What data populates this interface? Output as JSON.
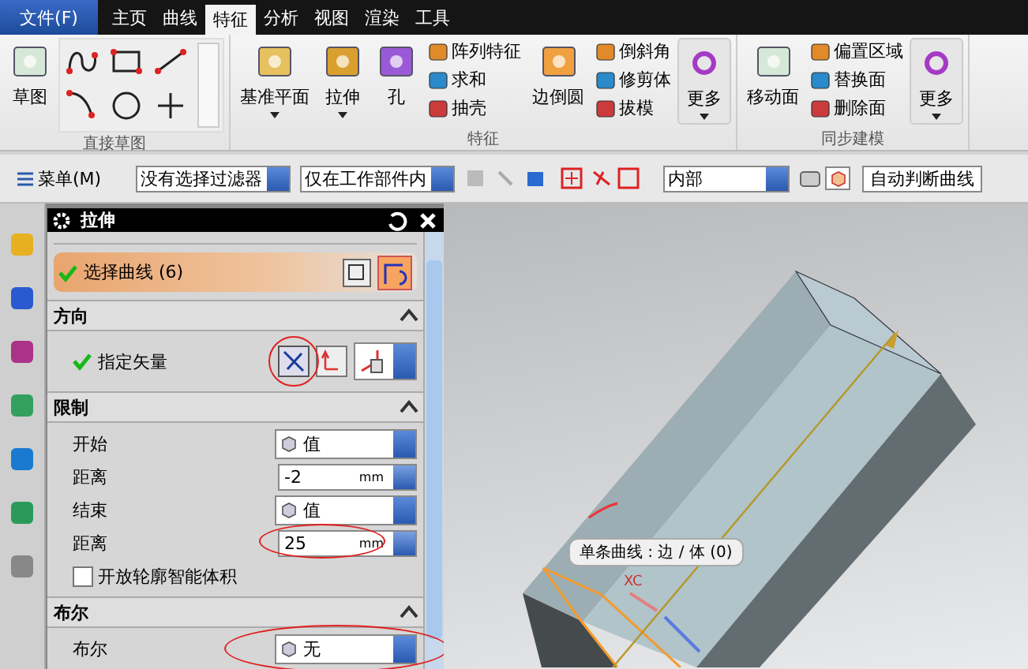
{
  "menu_bar": {
    "file_button": "文件(F)",
    "tabs": [
      {
        "label": "主页",
        "selected": false
      },
      {
        "label": "曲线",
        "selected": false
      },
      {
        "label": "特征",
        "selected": true
      },
      {
        "label": "分析",
        "selected": false
      },
      {
        "label": "视图",
        "selected": false
      },
      {
        "label": "渲染",
        "selected": false
      },
      {
        "label": "工具",
        "selected": false
      }
    ]
  },
  "ribbon": {
    "groups": [
      {
        "title": "直接草图",
        "items": [
          {
            "kind": "large",
            "label": "草图",
            "dropdown": false
          },
          {
            "kind": "sketch_tools"
          }
        ]
      },
      {
        "title": "特征",
        "items": [
          {
            "kind": "large",
            "label": "基准平面",
            "dropdown": true
          },
          {
            "kind": "large",
            "label": "拉伸",
            "dropdown": true
          },
          {
            "kind": "large",
            "label": "孔",
            "dropdown": false
          },
          {
            "kind": "stack",
            "labels": [
              "阵列特征",
              "求和",
              "抽壳"
            ]
          },
          {
            "kind": "large",
            "label": "边倒圆",
            "dropdown": false
          },
          {
            "kind": "stack",
            "labels": [
              "倒斜角",
              "修剪体",
              "拔模"
            ]
          },
          {
            "kind": "more",
            "label": "更多",
            "dropdown": true
          }
        ]
      },
      {
        "title": "同步建模",
        "items": [
          {
            "kind": "large",
            "label": "移动面",
            "dropdown": false
          },
          {
            "kind": "stack",
            "labels": [
              "偏置区域",
              "替换面",
              "删除面"
            ]
          },
          {
            "kind": "more",
            "label": "更多",
            "dropdown": true
          }
        ]
      }
    ]
  },
  "toolbar": {
    "menu_button": "菜单(M)",
    "filters": [
      "没有选择过滤器",
      "仅在工作部件内"
    ],
    "scope": "内部",
    "curve_rule": "自动判断曲线"
  },
  "dialog": {
    "title": "拉伸",
    "selection": {
      "label": "选择曲线 (6)",
      "checked": true
    },
    "sections": [
      {
        "title": "方向",
        "rows": [
          {
            "kind": "vector",
            "label": "指定矢量",
            "checked": true,
            "highlighted": true
          }
        ]
      },
      {
        "title": "限制",
        "rows": [
          {
            "kind": "dropdown",
            "label": "开始",
            "value": "值",
            "highlighted": false
          },
          {
            "kind": "number",
            "label": "距离",
            "value": "-2",
            "unit": "mm",
            "highlighted": false
          },
          {
            "kind": "dropdown",
            "label": "结束",
            "value": "值",
            "highlighted": false
          },
          {
            "kind": "number",
            "label": "距离",
            "value": "25",
            "unit": "mm",
            "highlighted": true
          },
          {
            "kind": "checkbox",
            "label": "开放轮廓智能体积",
            "checked": false
          }
        ]
      },
      {
        "title": "布尔",
        "rows": [
          {
            "kind": "dropdown",
            "label": "布尔",
            "value": "无",
            "highlighted": true
          }
        ]
      }
    ]
  },
  "viewport": {
    "tooltip": "单条曲线 : 边 / 体 (0)",
    "axis_label": "XC"
  }
}
